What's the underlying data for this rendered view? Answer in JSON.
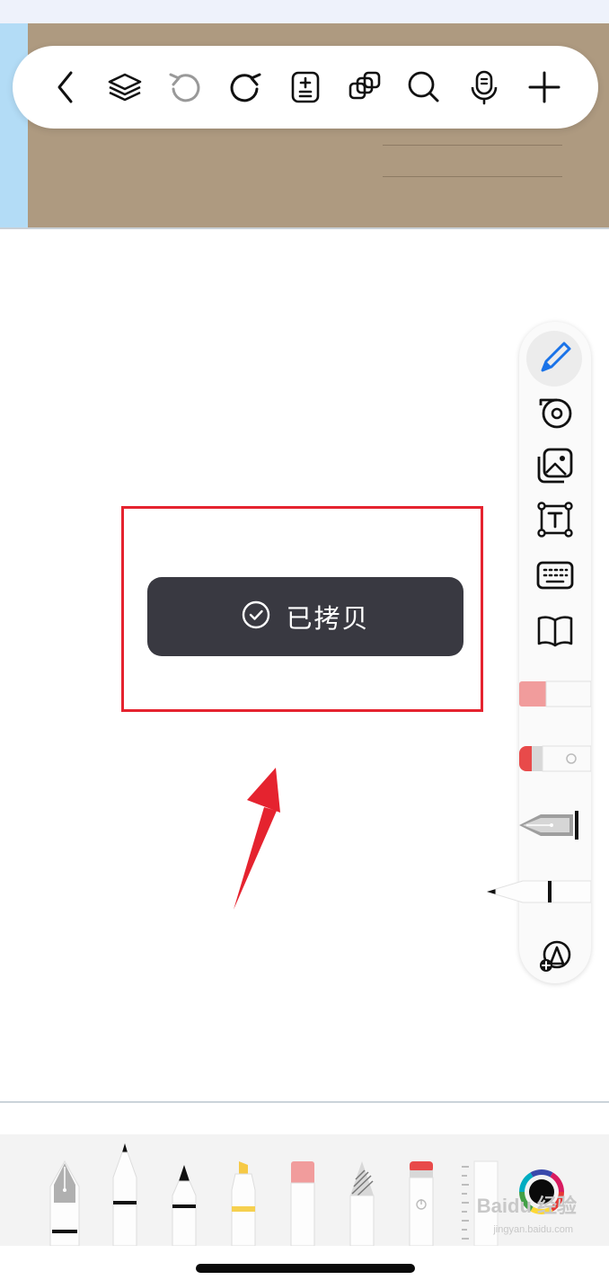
{
  "toolbar": {
    "icons": [
      "back-chevron-icon",
      "layers-icon",
      "undo-icon",
      "redo-icon",
      "page-add-icon",
      "duplicate-icon",
      "search-icon",
      "microphone-icon",
      "plus-icon"
    ]
  },
  "side_tools": {
    "icons": [
      "pencil-icon",
      "tape-icon",
      "image-icon",
      "text-box-icon",
      "keyboard-icon",
      "book-icon",
      "eraser-pink",
      "eraser-red",
      "fountain-pen",
      "fine-pen",
      "shapes-add-icon"
    ],
    "active": "pencil-icon",
    "accent_color": "#1a73e8"
  },
  "toast": {
    "message": "已拷贝"
  },
  "annotation": {
    "box_color": "#e5232f",
    "arrow_color": "#e5232f"
  },
  "pen_tray": {
    "tools": [
      "fountain-pen",
      "fineliner",
      "marker",
      "highlighter",
      "eraser",
      "pencil",
      "lasso-eraser",
      "ruler",
      "color-picker"
    ]
  },
  "watermark": {
    "text": "Baidu 经验",
    "sub": "jingyan.baidu.com"
  }
}
